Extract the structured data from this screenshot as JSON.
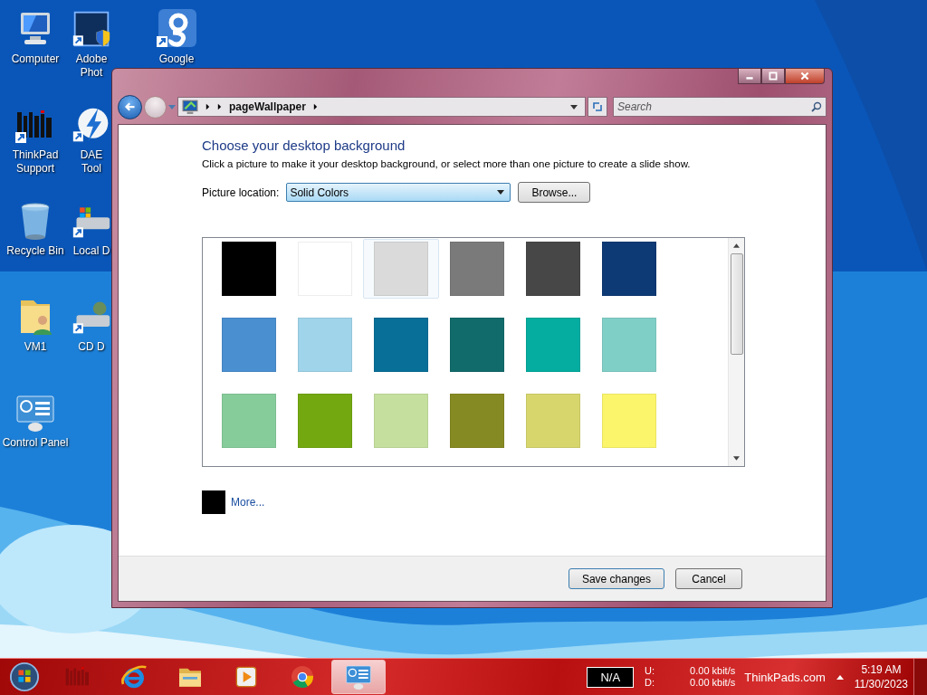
{
  "desktop": {
    "columns": [
      [
        {
          "kind": "computer",
          "label": [
            "Computer"
          ]
        },
        {
          "kind": "thinkpad",
          "label": [
            "ThinkPad",
            "Support"
          ]
        },
        {
          "kind": "recycle",
          "label": [
            "Recycle Bin"
          ]
        },
        {
          "kind": "user-folder",
          "label": [
            "VM1"
          ]
        },
        {
          "kind": "control-panel",
          "label": [
            "Control Panel"
          ]
        }
      ],
      [
        {
          "kind": "photo-editor",
          "label": [
            "Adobe",
            "Phot"
          ]
        },
        {
          "kind": "lightning",
          "label": [
            "DAE",
            "Tool"
          ]
        },
        {
          "kind": "disk",
          "label": [
            "Local D"
          ]
        },
        {
          "kind": "cd",
          "label": [
            "CD D"
          ]
        }
      ],
      [
        {
          "kind": "google",
          "label": [
            "Google"
          ]
        }
      ]
    ]
  },
  "window": {
    "address": {
      "crumbs": [
        "pageWallpaper"
      ]
    },
    "search": {
      "placeholder": "Search"
    },
    "heading": "Choose your desktop background",
    "description": "Click a picture to make it your desktop background, or select more than one picture to create a slide show.",
    "location_label": "Picture location:",
    "location": {
      "value": "Solid Colors"
    },
    "browse_button": "Browse...",
    "swatches": [
      {
        "color": "#000000",
        "selected": false
      },
      {
        "color": "#ffffff",
        "selected": false
      },
      {
        "color": "#dadada",
        "selected": true
      },
      {
        "color": "#7a7a7a",
        "selected": false
      },
      {
        "color": "#474747",
        "selected": false
      },
      {
        "color": "#0d3a75",
        "selected": false
      },
      {
        "color": "#4a8fd0",
        "selected": false
      },
      {
        "color": "#9fd4ea",
        "selected": false
      },
      {
        "color": "#086f98",
        "selected": false
      },
      {
        "color": "#126b6b",
        "selected": false
      },
      {
        "color": "#04ad9f",
        "selected": false
      },
      {
        "color": "#80cfc7",
        "selected": false
      },
      {
        "color": "#86cc9b",
        "selected": false
      },
      {
        "color": "#74a811",
        "selected": false
      },
      {
        "color": "#c5df9e",
        "selected": false
      },
      {
        "color": "#868a22",
        "selected": false
      },
      {
        "color": "#d7d66d",
        "selected": false
      },
      {
        "color": "#fbf56b",
        "selected": false
      }
    ],
    "more": {
      "color": "#000000",
      "label": "More..."
    },
    "buttons": [
      {
        "label": "Save changes",
        "kind": "default"
      },
      {
        "label": "Cancel",
        "kind": "normal"
      }
    ]
  },
  "taskbar": {
    "apps": [
      {
        "kind": "thinkpad",
        "selected": false
      },
      {
        "kind": "browser-e",
        "selected": false
      },
      {
        "kind": "folder",
        "selected": false
      },
      {
        "kind": "media",
        "selected": false
      },
      {
        "kind": "chrome",
        "selected": false
      },
      {
        "kind": "control-panel",
        "selected": true
      }
    ],
    "battery": "N/A",
    "net_labels": [
      "U:",
      "D:"
    ],
    "net_values": [
      "0.00 kbit/s",
      "0.00 kbit/s"
    ],
    "site": "ThinkPads.com",
    "time": "5:19 AM",
    "date": "11/30/2023"
  }
}
